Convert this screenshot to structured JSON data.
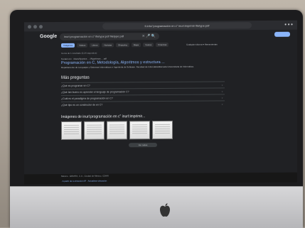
{
  "browser": {
    "url": "fi.info/“programación en c” inurl:imprimir filetype:pdf",
    "window_controls": "● ● ●"
  },
  "google": {
    "logo_text": "Google",
    "search_query": "inurl:programación en c” filetype:pdf filetype:pdf",
    "search_icons": "✕ 🎤 🔍",
    "tabs": [
      "Imágenes",
      "Videos",
      "Libros",
      "Noticias",
      "Shopping",
      "Maps",
      "Vuelos",
      "Finanzas"
    ],
    "tools": "Cualquier idioma ▾   Herramientas"
  },
  "results": {
    "meta": "Cerca de 1 resultado (0,24 segundos)",
    "top_result": {
      "site": "fi.unam.mx · /docs/Apuntes ... /Algoritmos ... pdf",
      "title": "Programación en C, Metodología, Algoritmos y estructura ...",
      "snippet": "Departamento de Lenguajes y Sistemas Informáticos e Ingeniería de Software. Facultad de Informática/Escuela Universitaria de Informática."
    },
    "paa_title": "Más preguntas",
    "paa_items": [
      "¿Qué es programar en C?",
      "¿Qué tan bueno es aprender el lenguaje de programación C?",
      "¿Cuál es el paradigma de programación en C?",
      "¿Qué tipo es un constructor de en C?"
    ],
    "images_title": "Imágenes de inurl:programación en c” inurl:imprimir...",
    "more_images": "Ver todas"
  },
  "footer": {
    "location": "México  ·  ERMITA, C.A., Ciudad de México, CDMX",
    "links": "· A partir de tu dirección IP · Actualizar ubicación"
  }
}
